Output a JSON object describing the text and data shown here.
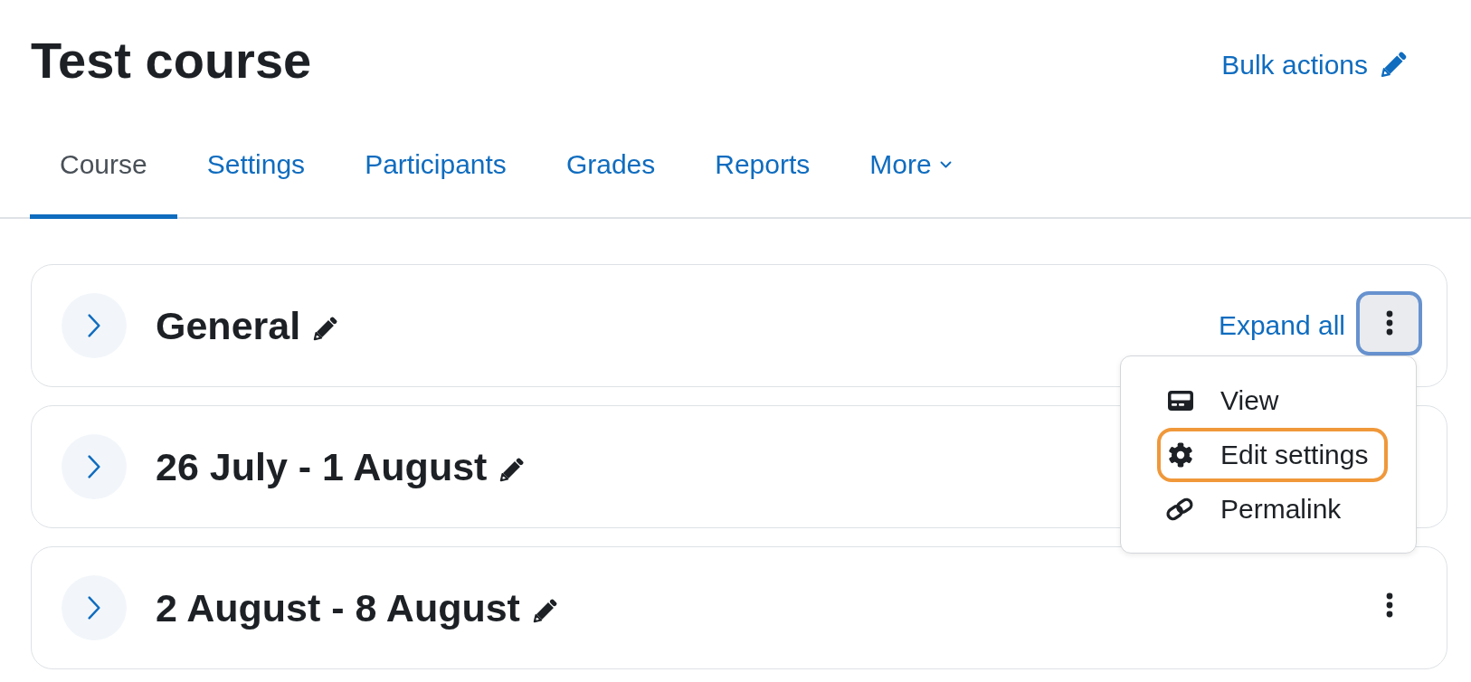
{
  "header": {
    "title": "Test course",
    "bulk_actions": "Bulk actions"
  },
  "tabs": [
    {
      "label": "Course",
      "selected": true,
      "kind": "link"
    },
    {
      "label": "Settings",
      "selected": false,
      "kind": "link"
    },
    {
      "label": "Participants",
      "selected": false,
      "kind": "link"
    },
    {
      "label": "Grades",
      "selected": false,
      "kind": "link"
    },
    {
      "label": "Reports",
      "selected": false,
      "kind": "link"
    },
    {
      "label": "More",
      "selected": false,
      "kind": "dropdown"
    }
  ],
  "sections": [
    {
      "title": "General",
      "expanded": false,
      "expand_all": "Expand all",
      "more_button": {
        "focused": true
      },
      "menu": {
        "items": [
          {
            "kind": "view",
            "label": "View",
            "focused": false
          },
          {
            "kind": "settings",
            "label": "Edit settings",
            "focused": true
          },
          {
            "kind": "link",
            "label": "Permalink",
            "focused": false
          }
        ]
      }
    },
    {
      "title": "26 July - 1 August",
      "expanded": false
    },
    {
      "title": "2 August - 8 August",
      "expanded": false,
      "more_button": {
        "focused": false
      }
    }
  ]
}
